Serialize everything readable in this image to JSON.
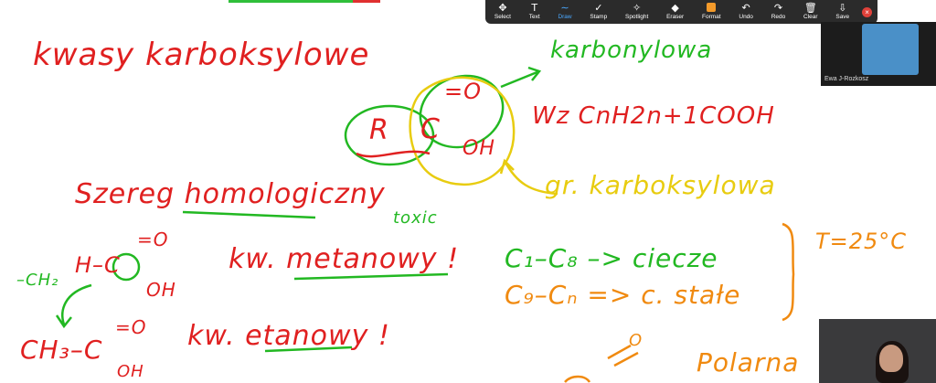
{
  "toolbar": {
    "tools": [
      {
        "label": "Select",
        "icon": "✥",
        "name": "select"
      },
      {
        "label": "Text",
        "icon": "T",
        "name": "text"
      },
      {
        "label": "Draw",
        "icon": "∼",
        "name": "draw",
        "active": true
      },
      {
        "label": "Stamp",
        "icon": "✓",
        "name": "stamp"
      },
      {
        "label": "Spotlight",
        "icon": "✧",
        "name": "spotlight"
      },
      {
        "label": "Eraser",
        "icon": "◆",
        "name": "eraser"
      },
      {
        "label": "Format",
        "icon": "",
        "name": "format"
      },
      {
        "label": "Undo",
        "icon": "↶",
        "name": "undo"
      },
      {
        "label": "Redo",
        "icon": "↷",
        "name": "redo"
      },
      {
        "label": "Clear",
        "icon": "🗑",
        "name": "clear"
      },
      {
        "label": "Save",
        "icon": "⇩",
        "name": "save"
      }
    ],
    "format_color": "#f39a2a",
    "close_icon": "×"
  },
  "participants": {
    "top_name": "Ewa J-Rozkosz"
  },
  "whiteboard": {
    "title": "kwasy karboksylowe",
    "karbonylowa": "karbonylowa",
    "formula_R": "R",
    "formula_C": "C",
    "formula_O": "=O",
    "formula_OH": "OH",
    "general": "Wz CnH2n+1COOH",
    "karboksylowa": "gr. karboksylowa",
    "szereg": "Szereg homologiczny",
    "toxic": "toxic",
    "h_c": "H–C",
    "o1": "=O",
    "oh1": "OH",
    "metanowy": "kw. metanowy !",
    "ch2": "–CH₂",
    "c1c8": "C₁–C₈ –> ciecze",
    "c9cn": "C₉–Cₙ => c. stałe",
    "temp": "T=25°C",
    "ch3": "CH₃–C",
    "o2": "=O",
    "oh2": "OH",
    "etanowy": "kw. etanowy !",
    "polarna": "Polarna",
    "o3": "O"
  },
  "colors": {
    "red": "#e02020",
    "green": "#22b822",
    "orange": "#f08a10",
    "yellow": "#e8cc10"
  }
}
